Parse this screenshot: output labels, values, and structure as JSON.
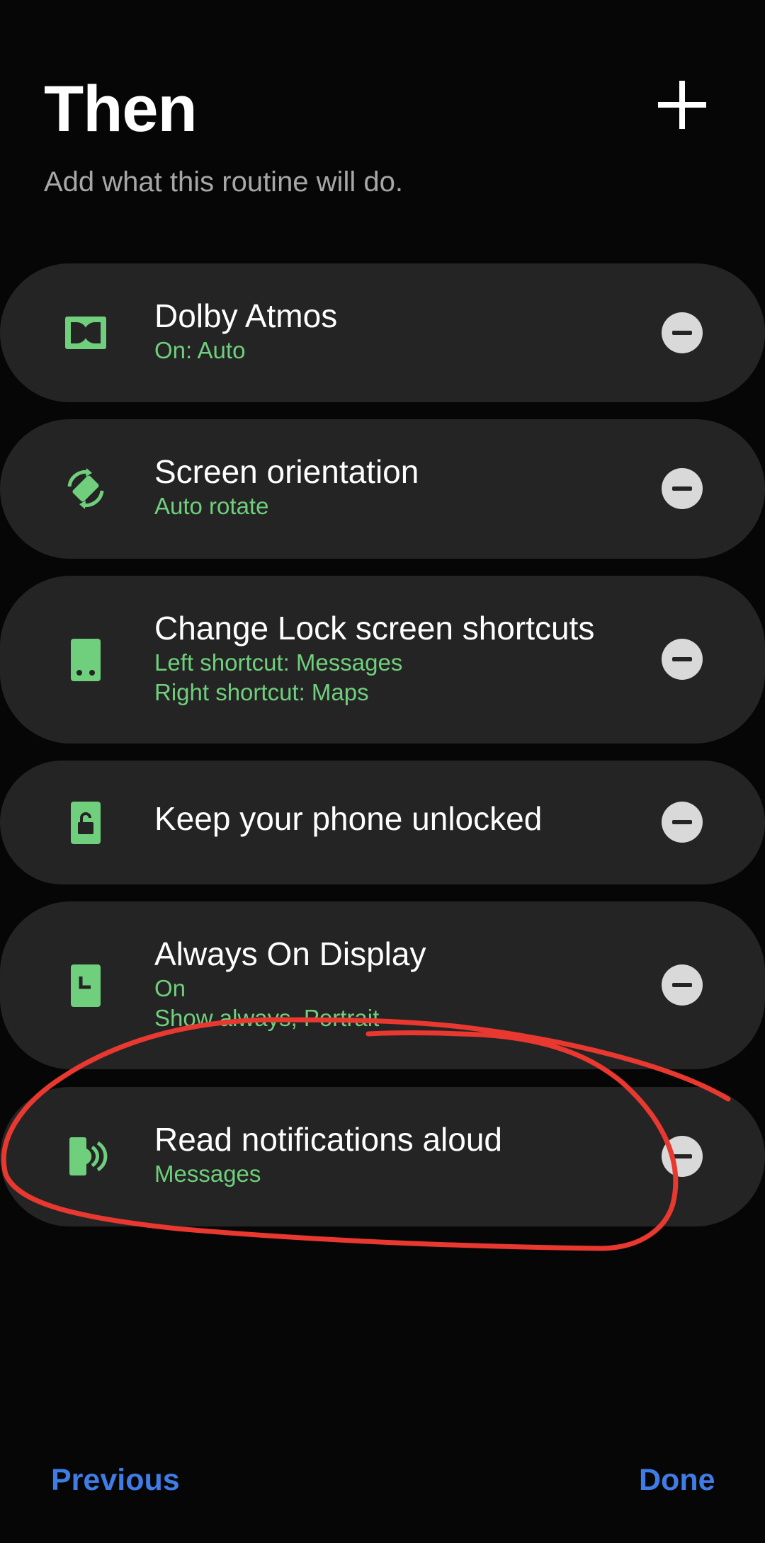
{
  "header": {
    "title": "Then",
    "subtitle": "Add what this routine will do."
  },
  "actions": [
    {
      "title": "Dolby Atmos",
      "lines": [
        "On: Auto"
      ],
      "icon": "dolby-icon"
    },
    {
      "title": "Screen orientation",
      "lines": [
        "Auto rotate"
      ],
      "icon": "auto-rotate-icon"
    },
    {
      "title": "Change Lock screen shortcuts",
      "lines": [
        "Left shortcut: Messages",
        "Right shortcut: Maps"
      ],
      "icon": "phone-shortcuts-icon"
    },
    {
      "title": "Keep your phone unlocked",
      "lines": [],
      "icon": "unlock-icon"
    },
    {
      "title": "Always On Display",
      "lines": [
        "On",
        "Show always, Portrait"
      ],
      "icon": "always-on-display-icon"
    },
    {
      "title": "Read notifications aloud",
      "lines": [
        "Messages"
      ],
      "icon": "read-aloud-icon"
    }
  ],
  "footer": {
    "previous_label": "Previous",
    "done_label": "Done"
  },
  "colors": {
    "background": "#060606",
    "card": "#242424",
    "accent_green": "#6fcf7c",
    "accent_blue": "#3f7ce6",
    "annotation_red": "#e8382f"
  }
}
